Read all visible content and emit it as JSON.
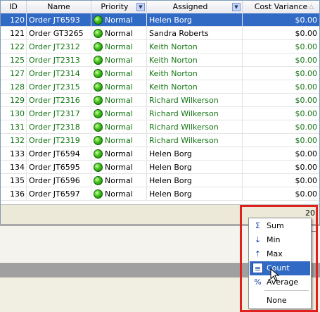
{
  "columns": {
    "id": "ID",
    "name": "Name",
    "priority": "Priority",
    "assigned": "Assigned",
    "cost": "Cost Variance"
  },
  "rows": [
    {
      "id": "120",
      "name": "Order JT6593",
      "priority": "Normal",
      "assigned": "Helen Borg",
      "cost": "$0.00",
      "style": "selected"
    },
    {
      "id": "121",
      "name": "Order GT3265",
      "priority": "Normal",
      "assigned": "Sandra Roberts",
      "cost": "$0.00",
      "style": "normal"
    },
    {
      "id": "122",
      "name": "Order JT2312",
      "priority": "Normal",
      "assigned": "Keith Norton",
      "cost": "$0.00",
      "style": "green"
    },
    {
      "id": "125",
      "name": "Order JT2313",
      "priority": "Normal",
      "assigned": "Keith Norton",
      "cost": "$0.00",
      "style": "green"
    },
    {
      "id": "127",
      "name": "Order JT2314",
      "priority": "Normal",
      "assigned": "Keith Norton",
      "cost": "$0.00",
      "style": "green"
    },
    {
      "id": "128",
      "name": "Order JT2315",
      "priority": "Normal",
      "assigned": "Keith Norton",
      "cost": "$0.00",
      "style": "green"
    },
    {
      "id": "129",
      "name": "Order JT2316",
      "priority": "Normal",
      "assigned": "Richard Wilkerson",
      "cost": "$0.00",
      "style": "green"
    },
    {
      "id": "130",
      "name": "Order JT2317",
      "priority": "Normal",
      "assigned": "Richard Wilkerson",
      "cost": "$0.00",
      "style": "green"
    },
    {
      "id": "131",
      "name": "Order JT2318",
      "priority": "Normal",
      "assigned": "Richard Wilkerson",
      "cost": "$0.00",
      "style": "green"
    },
    {
      "id": "132",
      "name": "Order JT2319",
      "priority": "Normal",
      "assigned": "Richard Wilkerson",
      "cost": "$0.00",
      "style": "green"
    },
    {
      "id": "133",
      "name": "Order JT6594",
      "priority": "Normal",
      "assigned": "Helen Borg",
      "cost": "$0.00",
      "style": "normal"
    },
    {
      "id": "134",
      "name": "Order JT6595",
      "priority": "Normal",
      "assigned": "Helen Borg",
      "cost": "$0.00",
      "style": "normal"
    },
    {
      "id": "135",
      "name": "Order JT6596",
      "priority": "Normal",
      "assigned": "Helen Borg",
      "cost": "$0.00",
      "style": "normal"
    },
    {
      "id": "136",
      "name": "Order JT6597",
      "priority": "Normal",
      "assigned": "Helen Borg",
      "cost": "$0.00",
      "style": "normal"
    }
  ],
  "footer": {
    "cost_summary": "20"
  },
  "menu": {
    "items": [
      {
        "label": "Sum",
        "icon": "sigma-icon",
        "glyph": "Σ"
      },
      {
        "label": "Min",
        "icon": "min-icon",
        "glyph": "⇣"
      },
      {
        "label": "Max",
        "icon": "max-icon",
        "glyph": "⇡"
      },
      {
        "label": "Count",
        "icon": "count-icon",
        "glyph": "≡"
      },
      {
        "label": "Average",
        "icon": "average-icon",
        "glyph": "%"
      }
    ],
    "none_label": "None",
    "highlighted": "Count"
  },
  "colors": {
    "selection": "#316ac5",
    "green_text": "#137513",
    "callout": "#e0201c"
  }
}
